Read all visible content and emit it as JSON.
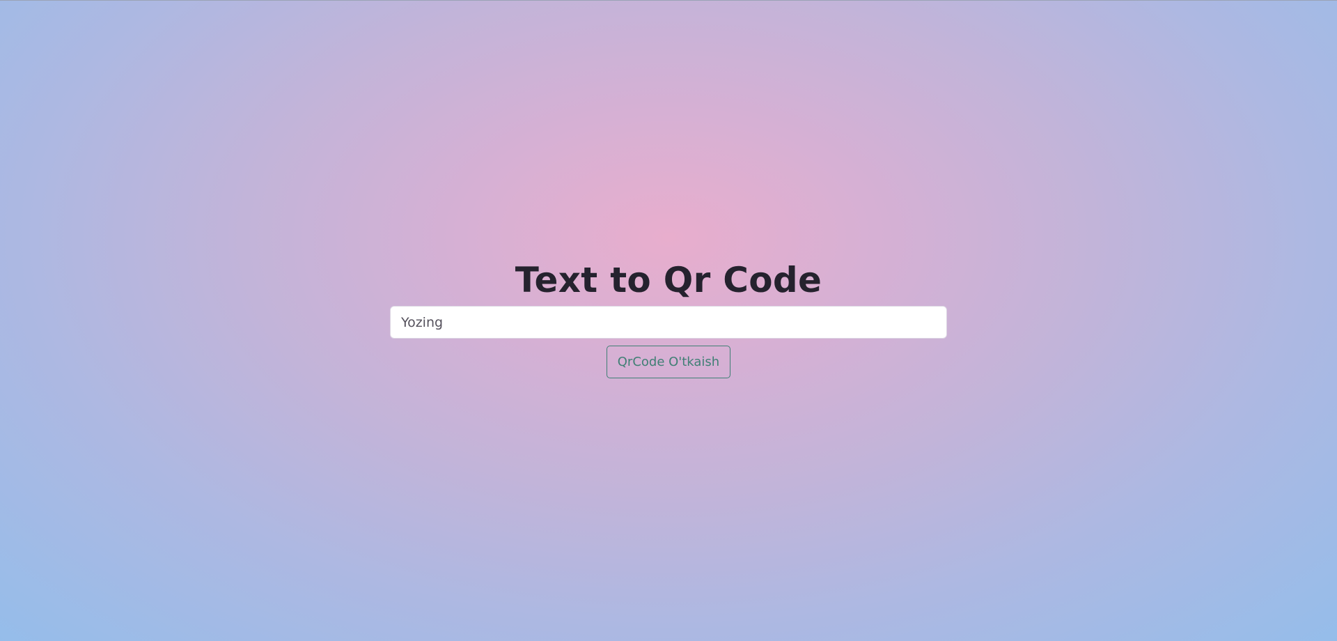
{
  "page": {
    "title": "Text to Qr Code"
  },
  "form": {
    "input_value": "Yozing",
    "button_label": "QrCode O'tkaish"
  },
  "colors": {
    "title": "#25222e",
    "button_outline": "#3f7f74",
    "background_center": "#e8aecd",
    "background_edge": "#95bdea"
  }
}
